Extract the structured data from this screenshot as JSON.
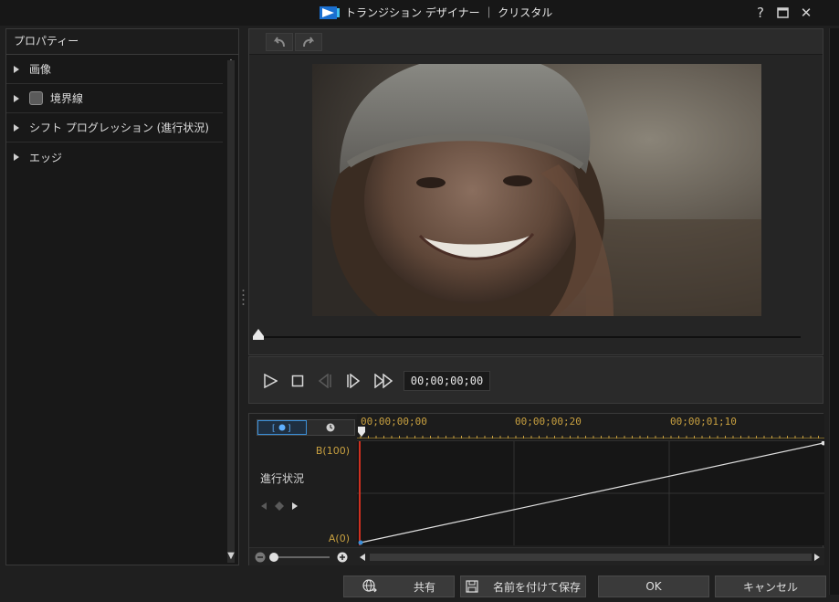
{
  "window": {
    "title": "トランジション デザイナー ｜ クリスタル",
    "help": "?",
    "maximize": "☐",
    "close": "✕"
  },
  "properties": {
    "header": "プロパティー",
    "items": [
      {
        "label": "画像",
        "checkbox": false
      },
      {
        "label": "境界線",
        "checkbox": true
      },
      {
        "label": "シフト プログレッション (進行状況)",
        "checkbox": false
      },
      {
        "label": "エッジ",
        "checkbox": false
      }
    ]
  },
  "player": {
    "timecode": "00;00;00;00"
  },
  "timeline": {
    "ruler_labels": [
      "00;00;00;00",
      "00;00;00;20",
      "00;00;01;10"
    ],
    "track_label": "進行状況",
    "y_max_label": "B(100)",
    "y_min_label": "A(0)"
  },
  "buttons": {
    "share": "共有",
    "save_as": "名前を付けて保存",
    "ok": "OK",
    "cancel": "キャンセル"
  },
  "colors": {
    "accent_orange": "#c8a040",
    "accent_blue": "#3a8fd8",
    "playhead_red": "#d03020"
  }
}
